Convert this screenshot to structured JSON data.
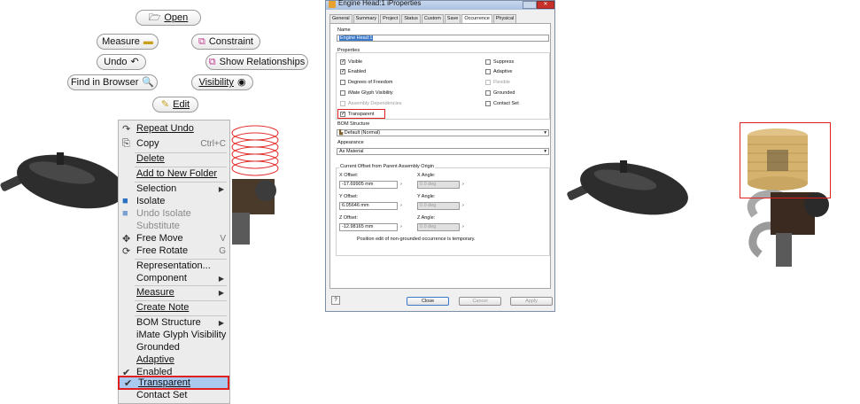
{
  "marking_menu": {
    "open": "Open",
    "measure": "Measure",
    "constraint": "Constraint",
    "undo": "Undo",
    "show_relationships": "Show Relationships",
    "find_in_browser": "Find in Browser",
    "visibility": "Visibility",
    "edit": "Edit"
  },
  "context_menu": {
    "repeat_undo": "Repeat Undo",
    "copy": "Copy",
    "copy_shortcut": "Ctrl+C",
    "delete": "Delete",
    "add_to_new_folder": "Add to New Folder",
    "selection": "Selection",
    "isolate": "Isolate",
    "undo_isolate": "Undo Isolate",
    "substitute": "Substitute",
    "free_move": "Free Move",
    "free_move_shortcut": "V",
    "free_rotate": "Free Rotate",
    "free_rotate_shortcut": "G",
    "representation": "Representation...",
    "component": "Component",
    "measure": "Measure",
    "create_note": "Create Note",
    "bom_structure": "BOM Structure",
    "imate_glyph_visibility": "iMate Glyph Visibility",
    "grounded": "Grounded",
    "adaptive": "Adaptive",
    "enabled": "Enabled",
    "transparent": "Transparent",
    "contact_set": "Contact Set"
  },
  "dialog": {
    "title": "Engine Head:1 iProperties",
    "tabs": [
      "General",
      "Summary",
      "Project",
      "Status",
      "Custom",
      "Save",
      "Occurrence",
      "Physical"
    ],
    "name_label": "Name",
    "name_value": "Engine Head:1",
    "properties_label": "Properties",
    "visible": "Visible",
    "enabled": "Enabled",
    "degrees_of_freedom": "Degrees of Freedom",
    "imate_glyph_visibility": "iMate Glyph Visibility",
    "assembly_dependencies": "Assembly Dependencies",
    "transparent": "Transparent",
    "suppress": "Suppress",
    "adaptive": "Adaptive",
    "flexible": "Flexible",
    "grounded": "Grounded",
    "contact_set": "Contact Set",
    "bom_structure_label": "BOM Structure",
    "bom_structure_value": "Default (Normal)",
    "appearance_label": "Appearance",
    "appearance_value": "As Material",
    "offset_group_label": "Current Offset from Parent Assembly Origin",
    "x_offset_label": "X Offset:",
    "x_offset_value": "-17.69905 mm",
    "x_angle_label": "X Angle:",
    "x_angle_value": "0.0 deg",
    "y_offset_label": "Y Offset:",
    "y_offset_value": "6.05646 mm",
    "y_angle_label": "Y Angle:",
    "y_angle_value": "0.0 deg",
    "z_offset_label": "Z Offset:",
    "z_offset_value": "-12.98165 mm",
    "z_angle_label": "Z Angle:",
    "z_angle_value": "0.0 deg",
    "note": "Position edit of non-grounded occurrence is temporary.",
    "close": "Close",
    "cancel": "Cancel",
    "apply": "Apply"
  }
}
